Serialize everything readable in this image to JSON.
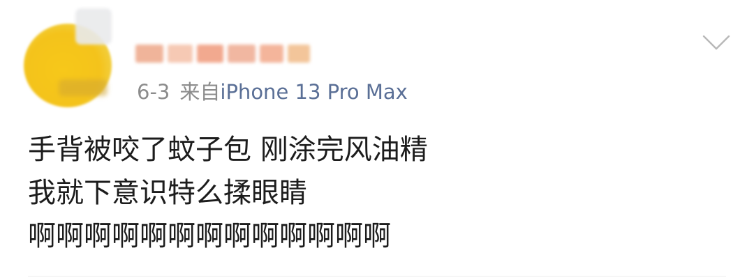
{
  "post": {
    "date": "6-3",
    "source_prefix": "来自",
    "source_device": "iPhone 13 Pro Max",
    "content_lines": [
      "手背被咬了蚊子包 刚涂完风油精",
      "我就下意识特么揉眼睛",
      "啊啊啊啊啊啊啊啊啊啊啊啊啊"
    ]
  },
  "icons": {
    "menu": "chevron-down-icon"
  },
  "colors": {
    "meta_text": "#8c8c8c",
    "source_link": "#5a6f96",
    "body_text": "#1c1c1c",
    "avatar": "#f4c31b"
  }
}
